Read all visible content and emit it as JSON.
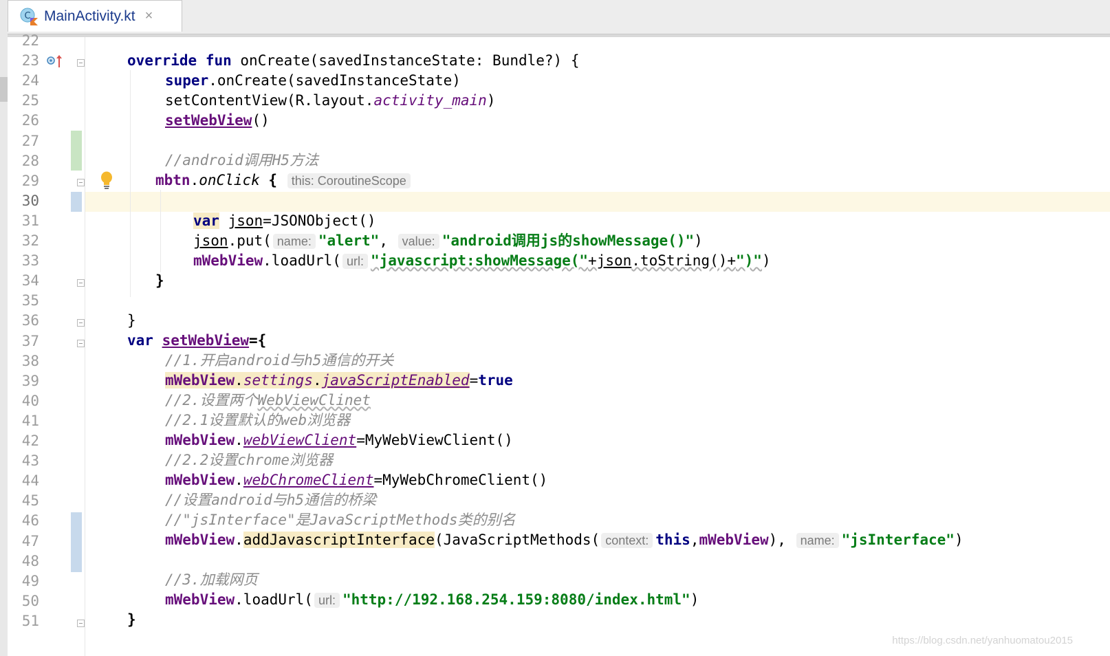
{
  "tab": {
    "filename": "MainActivity.kt",
    "close_symbol": "×"
  },
  "colors": {
    "keyword": "#000080",
    "string": "#067d17",
    "comment": "#8c8c8c",
    "property": "#660e7a",
    "current_line": "#fdf8e4",
    "vcs_added": "#c9e5c3",
    "vcs_modified": "#c7d9ec"
  },
  "line_numbers": [
    "22",
    "23",
    "24",
    "25",
    "26",
    "27",
    "28",
    "29",
    "30",
    "31",
    "32",
    "33",
    "34",
    "35",
    "36",
    "37",
    "38",
    "39",
    "40",
    "41",
    "42",
    "43",
    "44",
    "45",
    "46",
    "47",
    "48",
    "49",
    "50",
    "51"
  ],
  "code": {
    "l23": {
      "kw1": "override",
      "kw2": "fun",
      "rest": "onCreate(savedInstanceState: Bundle?) {"
    },
    "l24": {
      "kw": "super",
      "rest": ".onCreate(savedInstanceState)"
    },
    "l25": {
      "pre": "setContentView(R.layout.",
      "prop": "activity_main",
      "post": ")"
    },
    "l26": {
      "fn": "setWebView",
      "post": "()"
    },
    "l28": {
      "comment": "//android调用H5方法"
    },
    "l29": {
      "obj": "mbtn",
      "dot": ".",
      "method": "onClick",
      "brace": " {",
      "hint": "this: CoroutineScope"
    },
    "l31": {
      "kw": "var",
      "var": "json",
      "rest": "=JSONObject()"
    },
    "l32": {
      "var": "json",
      "pre": ".put(",
      "hint1": "name:",
      "str1": "\"alert\"",
      "comma": ", ",
      "hint2": "value:",
      "str2": "\"android调用js的showMessage()\"",
      "post": ")"
    },
    "l33": {
      "obj": "mWebView",
      "pre": ".loadUrl(",
      "hint": "url:",
      "str1": "\"javascript:showMessage(\"",
      "plus1": "+",
      "var": "json",
      "mid": ".toString()+",
      "str2": "\")\"",
      "post": ")"
    },
    "l34": {
      "text": "}"
    },
    "l36": {
      "text": "}"
    },
    "l37": {
      "kw": "var",
      "fn": "setWebView",
      "rest": "={"
    },
    "l38": {
      "comment": "//1.开启android与h5通信的开关"
    },
    "l39": {
      "obj": "mWebView",
      "dot1": ".",
      "prop1": "settings",
      "dot2": ".",
      "prop2": "javaScriptEnabled",
      "eq": "=",
      "kw": "true"
    },
    "l40": {
      "comment_a": "//2.设置两个",
      "comment_b": "WebViewClinet"
    },
    "l41": {
      "comment": "//2.1设置默认的web浏览器"
    },
    "l42": {
      "obj": "mWebView",
      "dot": ".",
      "prop": "webViewClient",
      "rest": "=MyWebViewClient()"
    },
    "l43": {
      "comment": "//2.2设置chrome浏览器"
    },
    "l44": {
      "obj": "mWebView",
      "dot": ".",
      "prop": "webChromeClient",
      "rest": "=MyWebChromeClient()"
    },
    "l45": {
      "comment": "//设置android与h5通信的桥梁"
    },
    "l46": {
      "comment": "//\"jsInterface\"是JavaScriptMethods类的别名"
    },
    "l47": {
      "obj": "mWebView",
      "dot": ".",
      "method": "addJavascriptInterface",
      "pre": "(JavaScriptMethods(",
      "hint1": "context:",
      "kw": "this",
      "comma": ",",
      "obj2": "mWebView",
      "mid": "), ",
      "hint2": "name:",
      "str": "\"jsInterface\"",
      "post": ")"
    },
    "l49": {
      "comment": "//3.加载网页"
    },
    "l50": {
      "obj": "mWebView",
      "pre": ".loadUrl(",
      "hint": "url:",
      "str": "\"http://192.168.254.159:8080/index.html\"",
      "post": ")"
    },
    "l51": {
      "text": "}"
    }
  },
  "watermark": "https://blog.csdn.net/yanhuomatou2015"
}
